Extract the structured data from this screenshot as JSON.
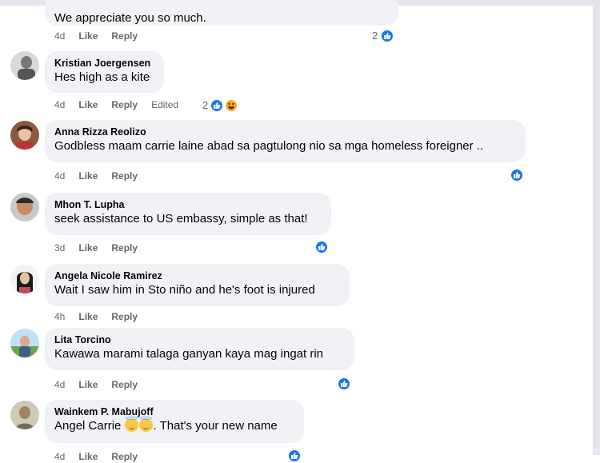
{
  "comments": [
    {
      "author": "",
      "text": "We appreciate you so much.",
      "time": "4d",
      "like": "Like",
      "reply": "Reply",
      "reactions": "2"
    },
    {
      "author": "Kristian Joergensen",
      "text": "Hes high as a kite",
      "time": "4d",
      "like": "Like",
      "reply": "Reply",
      "edited": "Edited",
      "reactions": "2"
    },
    {
      "author": "Anna Rizza Reolizo",
      "text": "Godbless maam carrie laine abad sa pagtulong nio sa mga homeless foreigner ..",
      "time": "4d",
      "like": "Like",
      "reply": "Reply"
    },
    {
      "author": "Mhon T. Lupha",
      "text": "seek assistance to US embassy, simple as that!",
      "time": "3d",
      "like": "Like",
      "reply": "Reply"
    },
    {
      "author": "Angela Nicole Ramirez",
      "text": "Wait I saw him in Sto niño and he's foot is injured",
      "time": "4h",
      "like": "Like",
      "reply": "Reply"
    },
    {
      "author": "Lita Torcino",
      "text": "Kawawa marami talaga ganyan kaya mag ingat rin",
      "time": "4d",
      "like": "Like",
      "reply": "Reply"
    },
    {
      "author": "Wainkem P. Mabujoff",
      "text_before": "Angel Carrie ",
      "text_after": ". That's your new name",
      "time": "4d",
      "like": "Like",
      "reply": "Reply"
    }
  ],
  "icons": {
    "like_reaction": "thumbs-up-icon",
    "haha_reaction": "haha-icon",
    "smile_emoji": "smiling-face-with-halo-icon"
  },
  "colors": {
    "bubble": "#f0f2f5",
    "like_blue": "#1877f2",
    "meta_gray": "#65676b"
  }
}
